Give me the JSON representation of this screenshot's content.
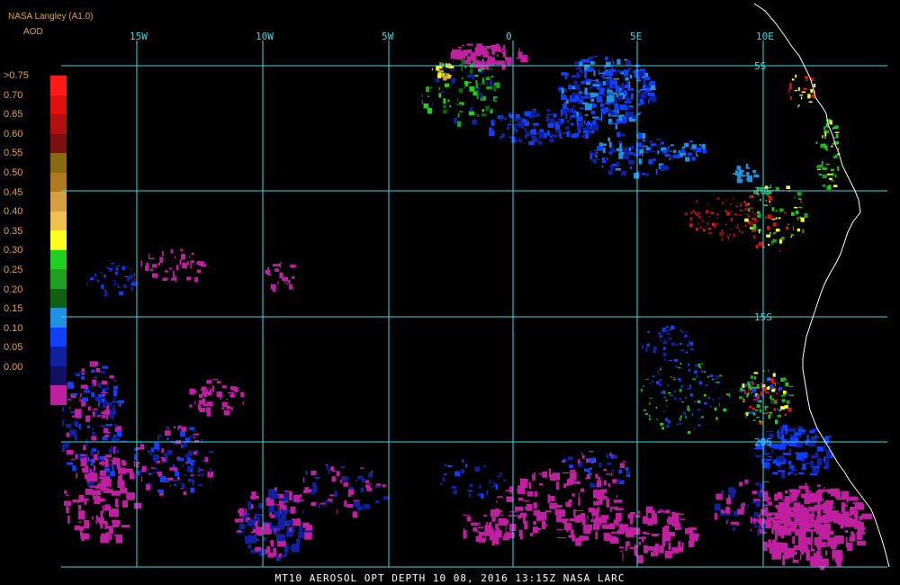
{
  "header": {
    "source": "NASA Langley (A1.0)",
    "product": "AOD"
  },
  "colorbar": {
    "labels": [
      ">0.75",
      "0.70",
      "0.65",
      "0.60",
      "0.55",
      "0.50",
      "0.45",
      "0.40",
      "0.35",
      "0.30",
      "0.25",
      "0.20",
      "0.15",
      "0.10",
      "0.05",
      "0.00"
    ],
    "colors": [
      "#ff1a1a",
      "#e01010",
      "#b01010",
      "#7a1010",
      "#8a6a10",
      "#b07a20",
      "#d6a040",
      "#f0c050",
      "#ffff20",
      "#20d020",
      "#20a020",
      "#106010",
      "#2090e0",
      "#1040ff",
      "#1020a0",
      "#101060",
      "#c020a0"
    ]
  },
  "axes": {
    "lon_labels": [
      "15W",
      "10W",
      "5W",
      "0",
      "5E",
      "10E"
    ],
    "lat_labels": [
      "5S",
      "10S",
      "15S",
      "20S"
    ]
  },
  "footer": {
    "text": "MT10  AEROSOL OPT DEPTH  10 08, 2016 13:15Z  NASA LARC"
  },
  "colors": {
    "grid": "#40d8e0",
    "coast": "#ffffff",
    "label": "#e0a040"
  }
}
